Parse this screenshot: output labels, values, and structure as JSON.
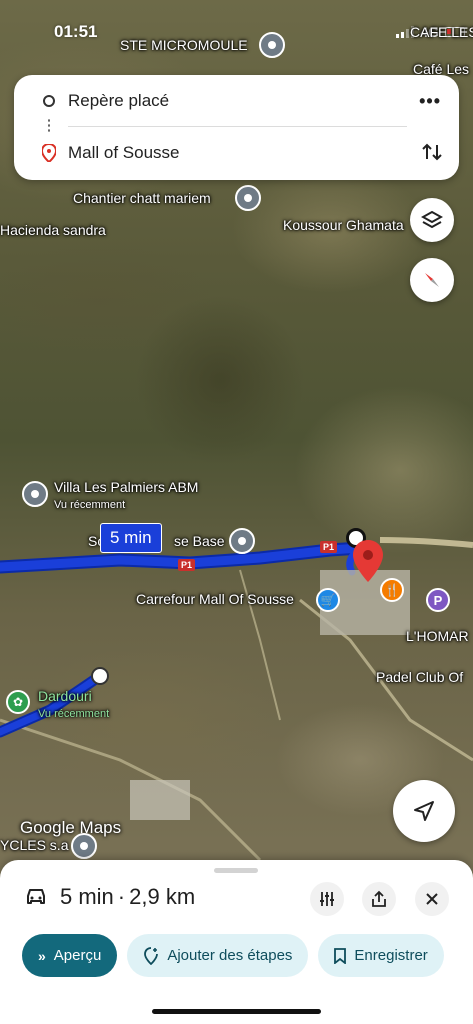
{
  "status_bar": {
    "time": "01:51",
    "network": "4G"
  },
  "route_card": {
    "origin": "Repère placé",
    "destination": "Mall of Sousse",
    "more_label": "•••"
  },
  "map": {
    "labels": {
      "ste_micromoule": "STE MICROMOULE",
      "cafe_les": "CAFE LES",
      "cafe_les_2": "Café Les",
      "chantier": "Chantier chatt mariem",
      "hacienda": "Hacienda sandra",
      "koussour": "Koussour Ghamata",
      "villa": "Villa Les Palmiers ABM",
      "villa_sub": "Vu récemment",
      "base_prefix": "So",
      "base_suffix": "se Base",
      "carrefour": "Carrefour Mall Of Sousse",
      "lhomar": "L'HOMAR",
      "padel": "Padel Club Of",
      "dardouri": "Dardouri",
      "dardouri_sub": "Vu récemment",
      "cycles": "YCLES s.a"
    },
    "route_time_chip": "5 min",
    "road_badge": "P1",
    "logo": "Google Maps"
  },
  "sheet": {
    "duration": "5 min",
    "separator": "·",
    "distance": "2,9 km",
    "chips": {
      "preview": "Aperçu",
      "add_stops": "Ajouter des étapes",
      "save": "Enregistrer"
    }
  },
  "colors": {
    "route": "#1a3fd9",
    "primary_chip": "#13697c",
    "secondary_chip": "#dff2f6",
    "destination_pin": "#e53935"
  }
}
